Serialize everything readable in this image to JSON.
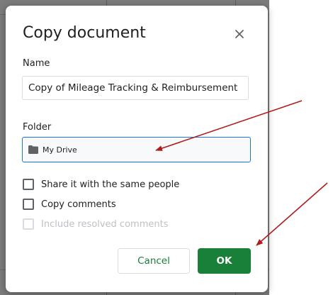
{
  "dialog": {
    "title": "Copy document",
    "close_icon": "close-icon",
    "name_label": "Name",
    "name_value": "Copy of Mileage Tracking & Reimbursement",
    "folder_label": "Folder",
    "folder_value": "My Drive",
    "folder_icon": "folder-icon",
    "options": [
      {
        "label": "Share it with the same people",
        "checked": false,
        "disabled": false
      },
      {
        "label": "Copy comments",
        "checked": false,
        "disabled": false
      },
      {
        "label": "Include resolved comments",
        "checked": false,
        "disabled": true
      }
    ],
    "cancel_label": "Cancel",
    "ok_label": "OK"
  },
  "colors": {
    "accent_green": "#188038",
    "focus_blue": "#1a73e8",
    "annotation_arrow": "#b01c1c",
    "backdrop": "#7c7c7c"
  }
}
